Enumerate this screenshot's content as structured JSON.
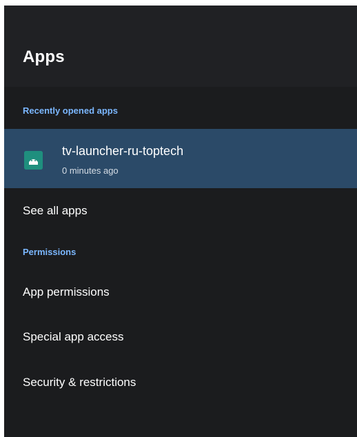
{
  "header": {
    "title": "Apps"
  },
  "recent": {
    "section_label": "Recently opened apps",
    "items": [
      {
        "name": "tv-launcher-ru-toptech",
        "time": "0 minutes ago",
        "icon": "android-app-icon"
      }
    ]
  },
  "actions": {
    "see_all": "See all apps"
  },
  "permissions": {
    "section_label": "Permissions",
    "items": [
      {
        "label": "App permissions"
      },
      {
        "label": "Special app access"
      },
      {
        "label": "Security & restrictions"
      }
    ]
  },
  "colors": {
    "background": "#1b1c1e",
    "header": "#202124",
    "selected_row": "#2b4a68",
    "accent": "#7bb7ff",
    "app_icon": "#1f8f7e",
    "text": "#ffffff",
    "secondary_text": "#d6dde5"
  }
}
